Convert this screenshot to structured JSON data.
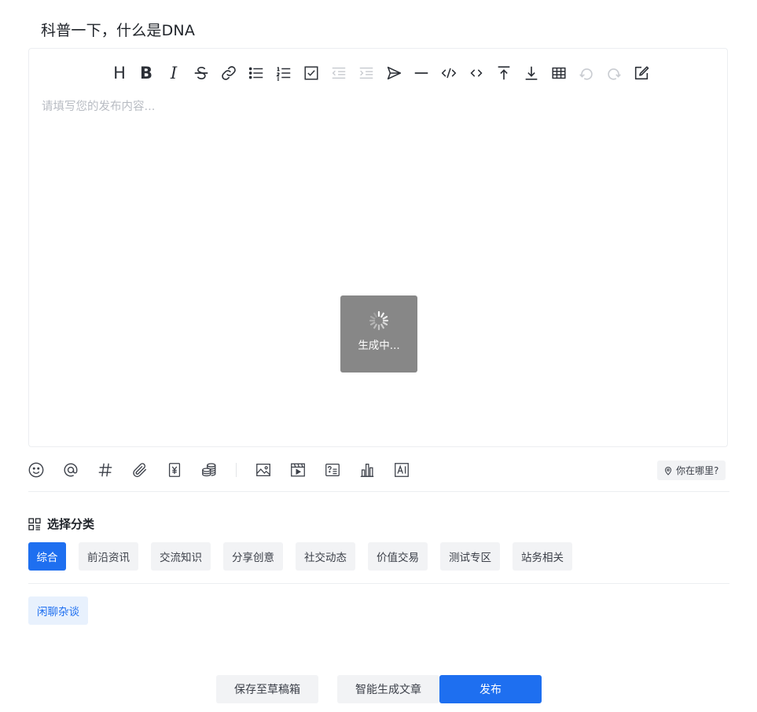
{
  "post": {
    "title": "科普一下，什么是DNA",
    "placeholder": "请填写您的发布内容...",
    "loading_text": "生成中..."
  },
  "toolbar": {
    "heading_label": "H",
    "bold_label": "B",
    "italic_label": "I",
    "items": [
      "heading",
      "bold",
      "italic",
      "strikethrough",
      "link",
      "bullet-list",
      "ordered-list",
      "task-list",
      "outdent",
      "indent",
      "quote",
      "hr",
      "inline-code",
      "code-block",
      "insert-before",
      "insert-after",
      "table",
      "undo",
      "redo",
      "preview"
    ]
  },
  "bottom_tools": [
    "emoji",
    "mention",
    "topic",
    "attachment",
    "paid-content",
    "coins",
    "image",
    "video",
    "question",
    "chart",
    "ai-text"
  ],
  "location": {
    "label": "你在哪里?"
  },
  "category": {
    "title": "选择分类",
    "items": [
      {
        "label": "综合",
        "active": true
      },
      {
        "label": "前沿资讯",
        "active": false
      },
      {
        "label": "交流知识",
        "active": false
      },
      {
        "label": "分享创意",
        "active": false
      },
      {
        "label": "社交动态",
        "active": false
      },
      {
        "label": "价值交易",
        "active": false
      },
      {
        "label": "测试专区",
        "active": false
      },
      {
        "label": "站务相关",
        "active": false
      }
    ],
    "tags": [
      {
        "label": "闲聊杂谈"
      }
    ]
  },
  "actions": {
    "save_draft": "保存至草稿箱",
    "ai_generate": "智能生成文章",
    "publish": "发布"
  },
  "colors": {
    "primary": "#1e6ff0",
    "chip_bg": "#f2f3f5",
    "tag_bg": "#e8f1fd"
  }
}
